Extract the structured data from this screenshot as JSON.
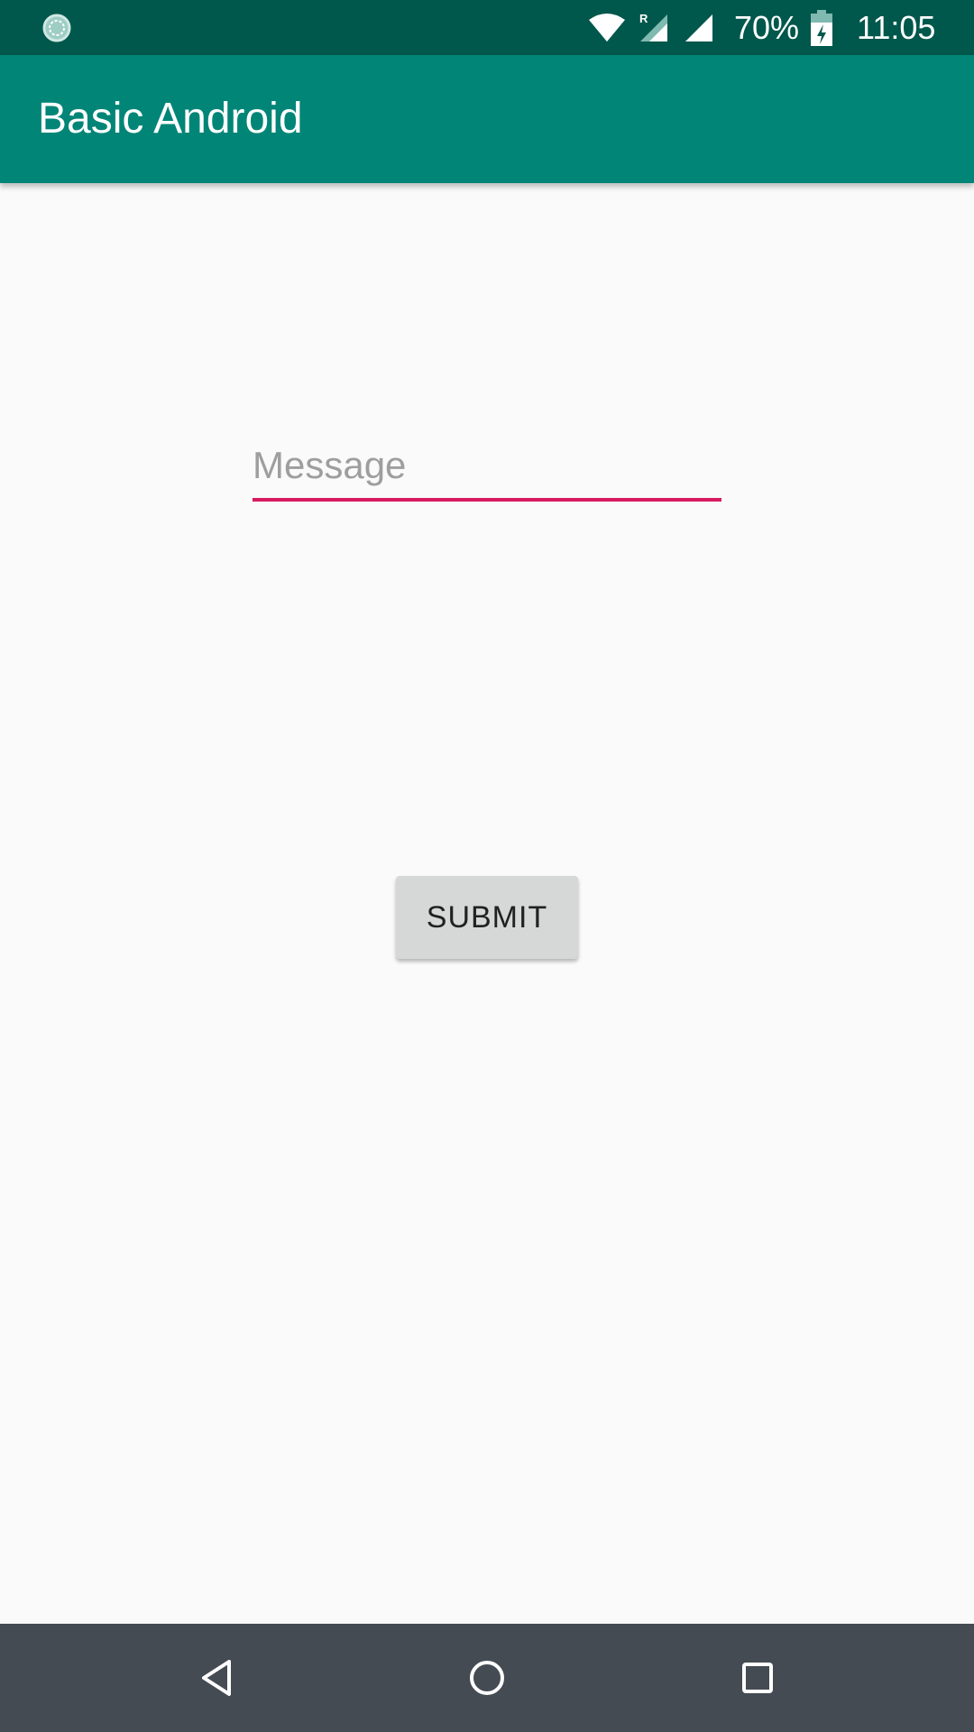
{
  "status_bar": {
    "battery_percent": "70%",
    "time": "11:05",
    "icons": [
      "sync-icon",
      "wifi-icon",
      "roaming-signal-icon",
      "signal-icon",
      "battery-charging-icon"
    ],
    "roaming_letter": "R"
  },
  "app_bar": {
    "title": "Basic Android",
    "color": "#008577"
  },
  "form": {
    "message_placeholder": "Message",
    "message_value": "",
    "underline_color": "#d81b60",
    "submit_label": "SUBMIT"
  },
  "nav_bar": {
    "icons": [
      "back-icon",
      "home-icon",
      "recents-icon"
    ]
  }
}
